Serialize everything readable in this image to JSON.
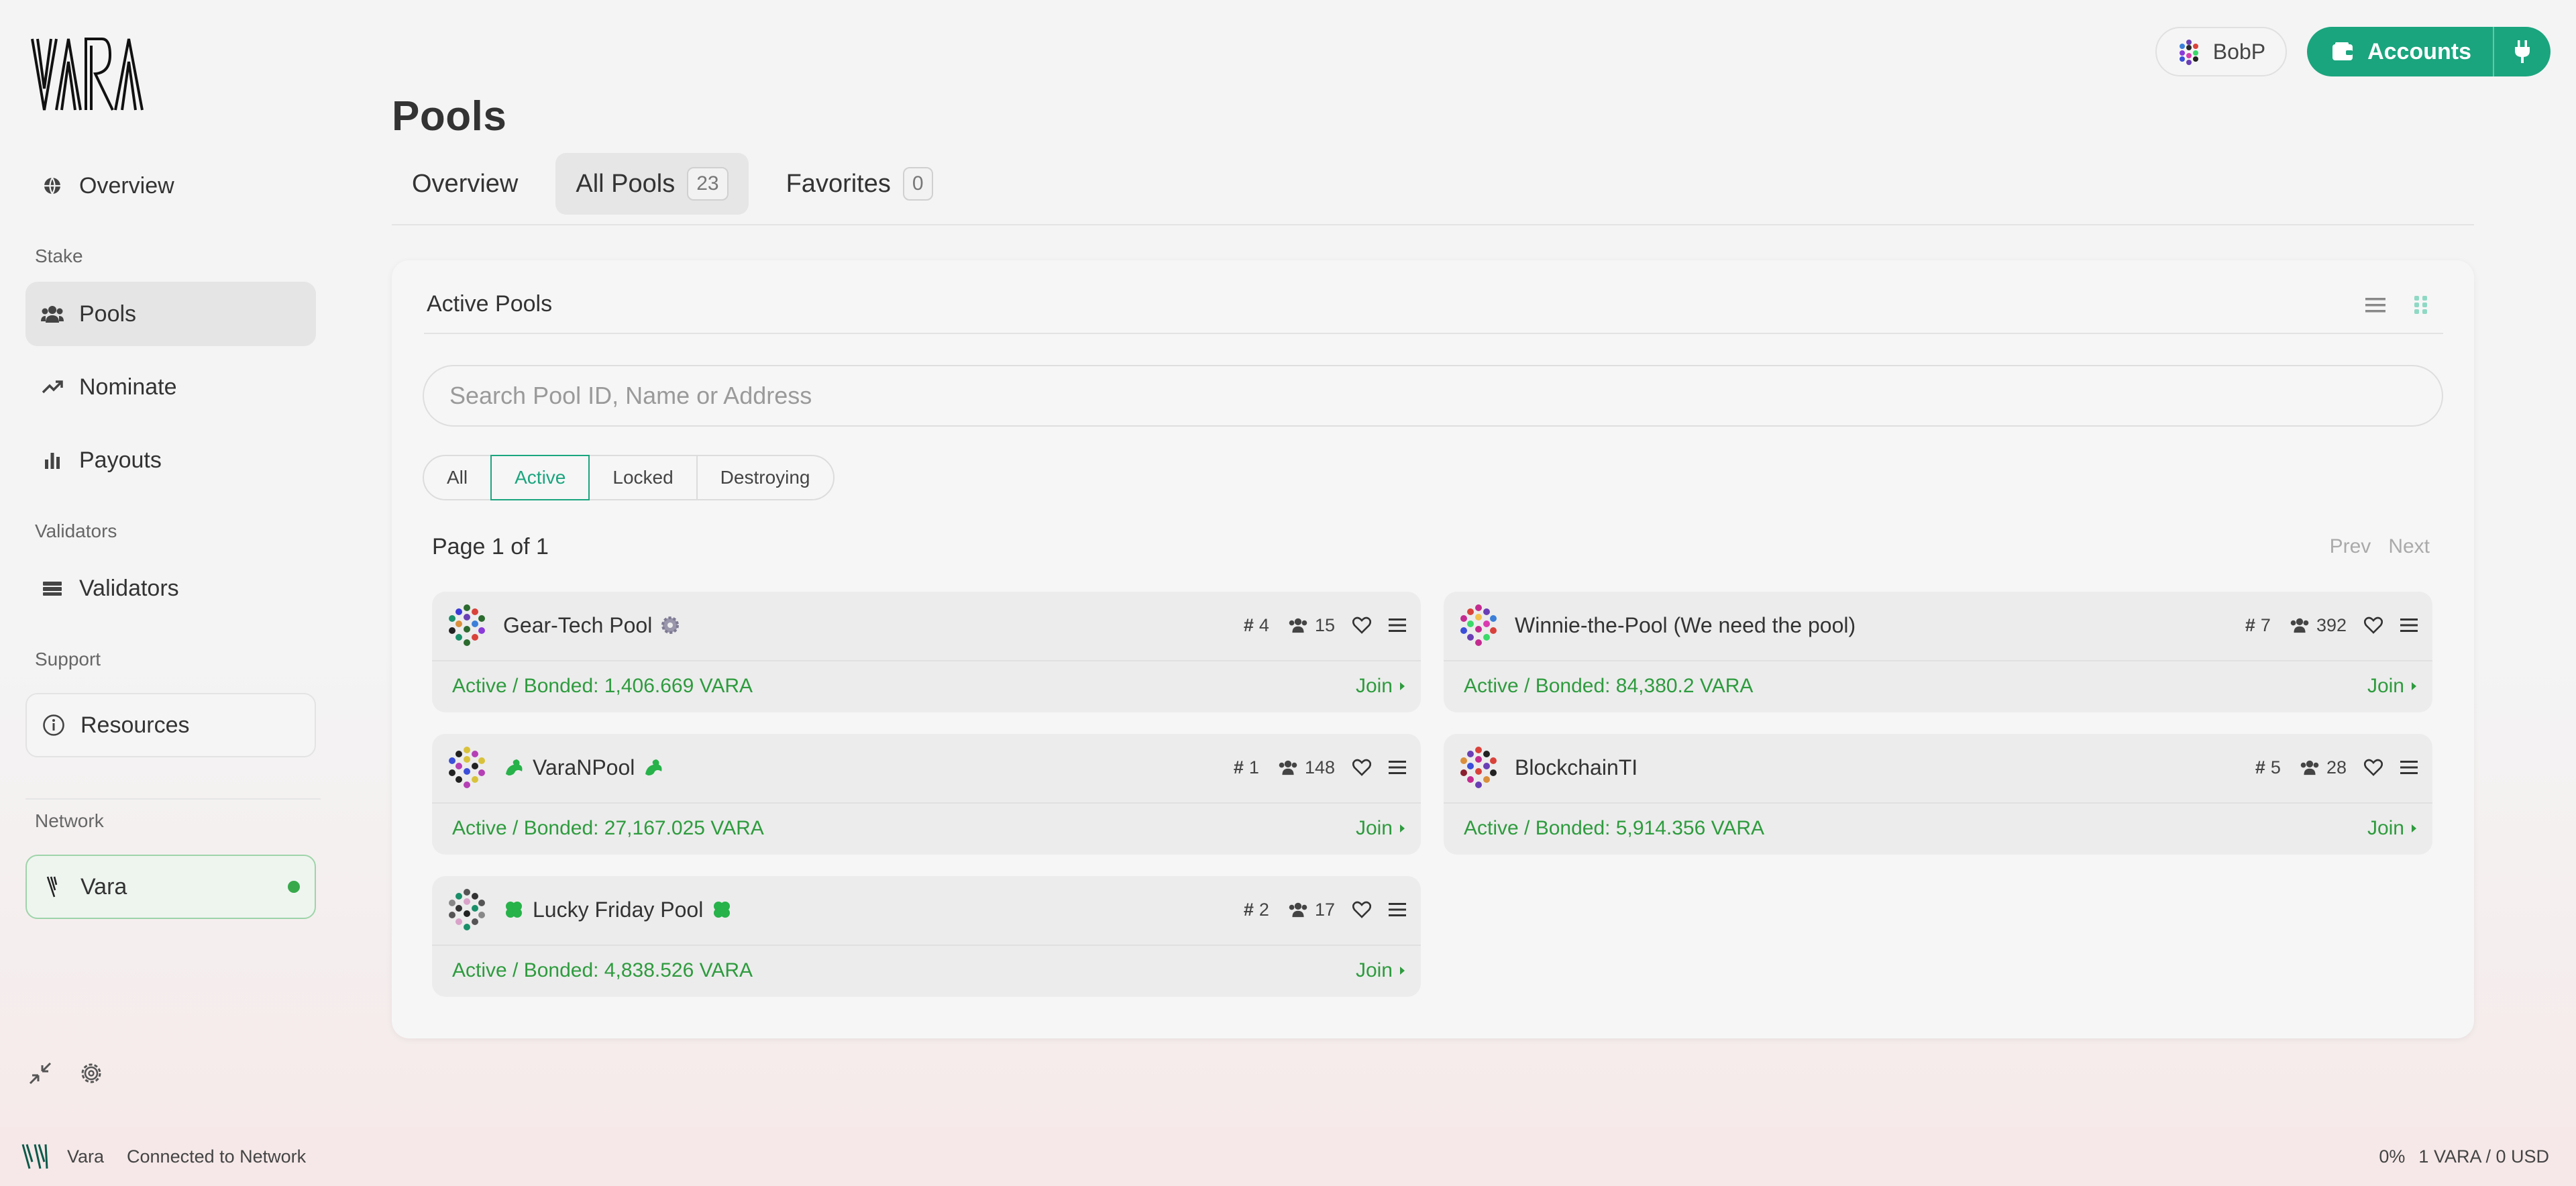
{
  "sidebar": {
    "logo_text": "VARA",
    "overview": "Overview",
    "stake_label": "Stake",
    "pools": "Pools",
    "nominate": "Nominate",
    "payouts": "Payouts",
    "validators_label": "Validators",
    "validators": "Validators",
    "support_label": "Support",
    "resources": "Resources",
    "network_label": "Network",
    "network": "Vara"
  },
  "header": {
    "user": "BobP",
    "accounts": "Accounts"
  },
  "main": {
    "title": "Pools",
    "tabs": [
      {
        "label": "Overview"
      },
      {
        "label": "All Pools",
        "count": "23"
      },
      {
        "label": "Favorites",
        "count": "0"
      }
    ],
    "card_title": "Active Pools",
    "search_placeholder": "Search Pool ID, Name or Address",
    "filters": [
      "All",
      "Active",
      "Locked",
      "Destroying"
    ],
    "active_filter": "Active",
    "page_info": "Page 1 of 1",
    "prev": "Prev",
    "next": "Next"
  },
  "pools": [
    {
      "name": "Gear-Tech Pool",
      "id": "4",
      "members": "15",
      "status": "Active / Bonded: 1,406.669 VARA",
      "join": "Join"
    },
    {
      "name": "Winnie-the-Pool (We need the pool)",
      "id": "7",
      "members": "392",
      "status": "Active / Bonded: 84,380.2 VARA",
      "join": "Join"
    },
    {
      "name": "VaraNPool",
      "id": "1",
      "members": "148",
      "status": "Active / Bonded: 27,167.025 VARA",
      "join": "Join"
    },
    {
      "name": "BlockchainTI",
      "id": "5",
      "members": "28",
      "status": "Active / Bonded: 5,914.356 VARA",
      "join": "Join"
    },
    {
      "name": "Lucky Friday Pool",
      "id": "2",
      "members": "17",
      "status": "Active / Bonded: 4,838.526 VARA",
      "join": "Join"
    }
  ],
  "footer": {
    "network": "Vara",
    "connection": "Connected to Network",
    "percent": "0%",
    "price": "1 VARA / 0 USD"
  },
  "colors": {
    "accent": "#1aa57e",
    "status_green": "#2e9b3e",
    "network_dot": "#37a94b"
  }
}
